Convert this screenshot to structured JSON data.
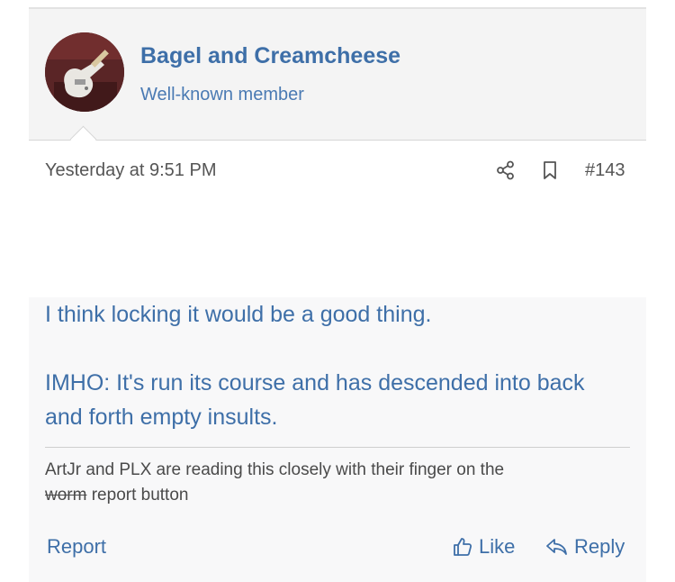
{
  "user": {
    "name": "Bagel and Creamcheese",
    "title": "Well-known member"
  },
  "meta": {
    "timestamp": "Yesterday at 9:51 PM",
    "post_number": "#143",
    "share_icon": "share-icon",
    "bookmark_icon": "bookmark-icon"
  },
  "message": {
    "paragraphs": [
      "I think locking it would be a good thing.",
      "IMHO: It's run its course and has descended into back and forth empty insults."
    ]
  },
  "signature": {
    "text_before": "ArtJr and PLX are reading this closely with their finger on the",
    "struck": "worm",
    "text_after": "report button"
  },
  "actions": {
    "report_label": "Report",
    "like_label": "Like",
    "reply_label": "Reply",
    "like_icon": "thumbs-up-icon",
    "reply_icon": "reply-arrow-icon"
  },
  "colors": {
    "link": "#3e6fa8",
    "header_bg": "#f4f4f4",
    "body_bg": "#f8f8f9"
  }
}
